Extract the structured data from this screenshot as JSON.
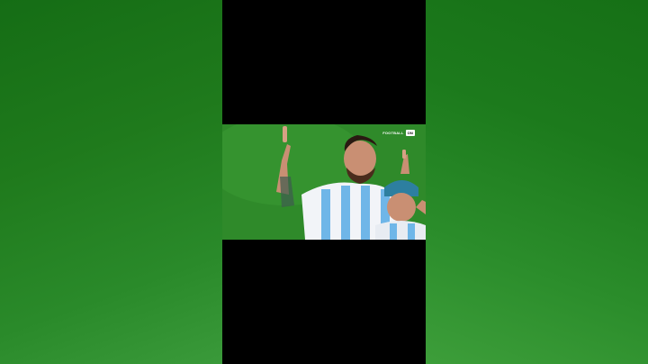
{
  "watermark": {
    "text": "FOOTBALL",
    "badge": "ON"
  },
  "colors": {
    "pitch": "#2f8a2a",
    "letterbox": "#000000",
    "jersey_blue": "#6fb6e8",
    "jersey_white": "#f2f4f8",
    "cap": "#2d7fa0"
  },
  "icons": [
    "raised-finger-gesture"
  ]
}
